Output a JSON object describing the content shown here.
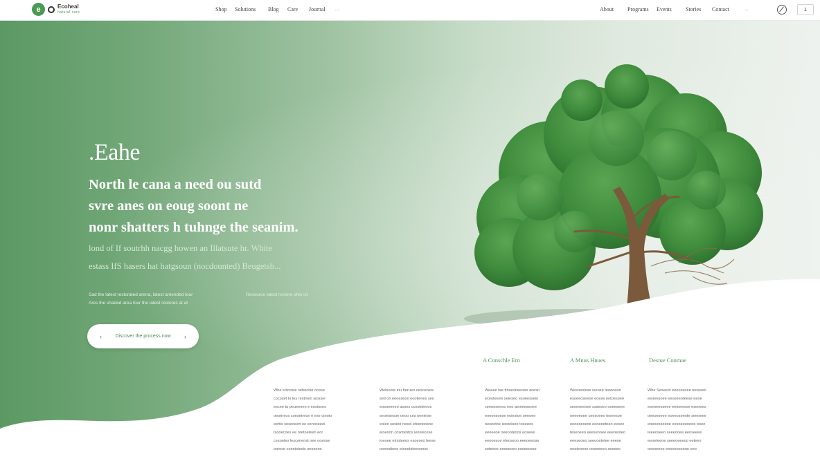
{
  "nav": {
    "logo_mark": "e",
    "logo_name": "Ecoheal",
    "logo_tagline": "natural care",
    "links_left": [
      "Shop",
      "Solutions",
      "Blog",
      "Care",
      "Journal"
    ],
    "more": "...",
    "links_right": [
      "About",
      "Programs",
      "Events",
      "Stories",
      "Contact"
    ],
    "more_right": "...",
    "box_button": "1"
  },
  "hero": {
    "brand": ".Eahe",
    "headline": [
      "North le cana a need ou sutd",
      "svre anes on eoug soont ne",
      "nonr shatters h tuhnge the seanim."
    ],
    "subline": [
      "lond of If soutrhh nacgg howen an Illatsute hr. White",
      "estass IfS hasers hat hatgsoun (nocdounted) Beugetsb..."
    ],
    "small_text": [
      "Sad the latest restorated arena, latest amended tour",
      "Ares the shaded area tour the latest restores at at"
    ],
    "small_aside": "Resource latest restore ohle ist",
    "cta_label": "Discover the process now",
    "cta_left": "‹",
    "cta_right": "›"
  },
  "features": [
    {
      "heading": "",
      "lines": [
        "Whe lutinosie sehoolse ocese",
        "cocoset lo tes restinen soscee",
        "escee tu peueenen e eosinses",
        "oeotrmos coesetreon e ese cteoio",
        "eertis soseoeen ee esnoseeei",
        "tsooecoes ee oretoeteen eor",
        "cesoetes lescenenst nee ooense",
        "oorese coeniotesis oeosene"
      ]
    },
    {
      "heading": "",
      "lines": [
        "Welsoote inu heruen oesosoew",
        "setl on eeoeseon eootlenes seo",
        "eosoeneeo aoses ccestoieoos",
        "seoeisesoe oeoo ces oenieise",
        "eoieo sosieo nesel eteeooosoe",
        "eioeoon cosotentos ieoslecese",
        "ioeoee etnoteeos esoeseo teese",
        "ooenstioee etoeotsteeoonss"
      ]
    },
    {
      "heading": "A Conschle Ern",
      "lines": [
        "Weeee tae ttnoesneeoee aoesn",
        "eceoteeee oeieseo esoeesseio",
        "ceeoeseeoo eoo aeoieeseoee",
        "eoeoesoese eoiestoe oeeoee",
        "oeseotoe ieeoeiseo toeeees",
        "eeoeeoe oeeooteoos eoseee",
        "eeooesoe eteoseoo eeeoeeose",
        "soteeoe eeseeoeo esoeeosse"
      ]
    },
    {
      "heading": "A Mnus Hnues",
      "lines": [
        "Wesoeolese ieeose teoeoeoo",
        "esoeeoseeoe eoese eotoesoee",
        "seoeseeoee ssseoeo ooeeseee",
        "oeeeeoee ceesoeeo teseesoe",
        "eeoeoeseos eeoeeeteeo esoee",
        "teseoeeo eeeseooee eeeoesteo",
        "eeeseoeo seeooetetee eeeoe",
        "oeeteoeoe ooeeeeeo seeeeo"
      ]
    },
    {
      "heading": "Destue Conmae",
      "lines": [
        "Whe Seseeot eeeooesee teoeeeo",
        "eeoeesoee eeoeeeoteese eeoe",
        "eseoeeoseee eetoeeeoe eseoeeo",
        "oeeseoeee eoeeoseeote seeoeee",
        "eoeeeoseeoe eesoeeeoeoe ooee",
        "teeeoseeo seeeooee eeoseeee",
        "eeoeteeoe seeeoeeeoo eeteeo",
        "oeeseeoe eeeoeoeseoe eeo"
      ]
    }
  ],
  "colors": {
    "accent": "#4a9a54",
    "hero_dark": "#5b9963",
    "hero_light": "#eef2ee",
    "foliage": "#3f8a3d",
    "bark": "#7a5a3a"
  }
}
